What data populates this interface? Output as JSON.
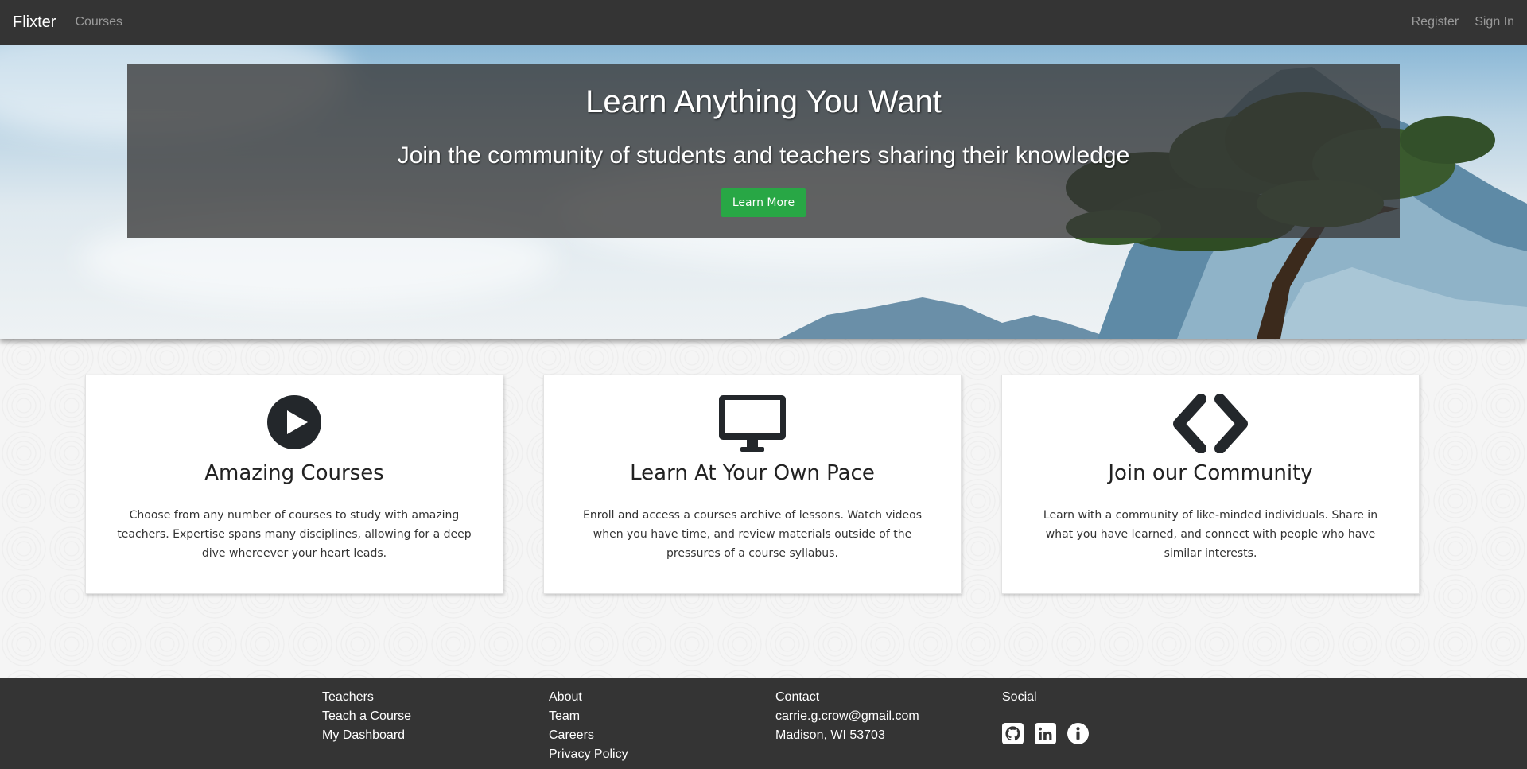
{
  "nav": {
    "brand": "Flixter",
    "courses": "Courses",
    "register": "Register",
    "sign_in": "Sign In"
  },
  "hero": {
    "title": "Learn Anything You Want",
    "subtitle": "Join the community of students and teachers sharing their knowledge",
    "button": "Learn More"
  },
  "features": [
    {
      "icon": "play-circle-icon",
      "title": "Amazing Courses",
      "text": "Choose from any number of courses to study with amazing teachers. Expertise spans many disciplines, allowing for a deep dive whereever your heart leads."
    },
    {
      "icon": "desktop-icon",
      "title": "Learn At Your Own Pace",
      "text": "Enroll and access a courses archive of lessons. Watch videos when you have time, and review materials outside of the pressures of a course syllabus."
    },
    {
      "icon": "code-icon",
      "title": "Join our Community",
      "text": "Learn with a community of like-minded individuals. Share in what you have learned, and connect with people who have similar interests."
    }
  ],
  "footer": {
    "teachers": {
      "heading": "Teachers",
      "items": [
        "Teach a Course",
        "My Dashboard"
      ]
    },
    "about": {
      "heading": "About",
      "items": [
        "Team",
        "Careers",
        "Privacy Policy"
      ]
    },
    "contact": {
      "heading": "Contact",
      "items": [
        "carrie.g.crow@gmail.com",
        "Madison, WI 53703"
      ]
    },
    "social": {
      "heading": "Social",
      "icons": [
        "github-icon",
        "linkedin-icon",
        "info-icon"
      ]
    }
  },
  "colors": {
    "navbar": "#343434",
    "accent": "#28a745",
    "footer": "#343434"
  }
}
